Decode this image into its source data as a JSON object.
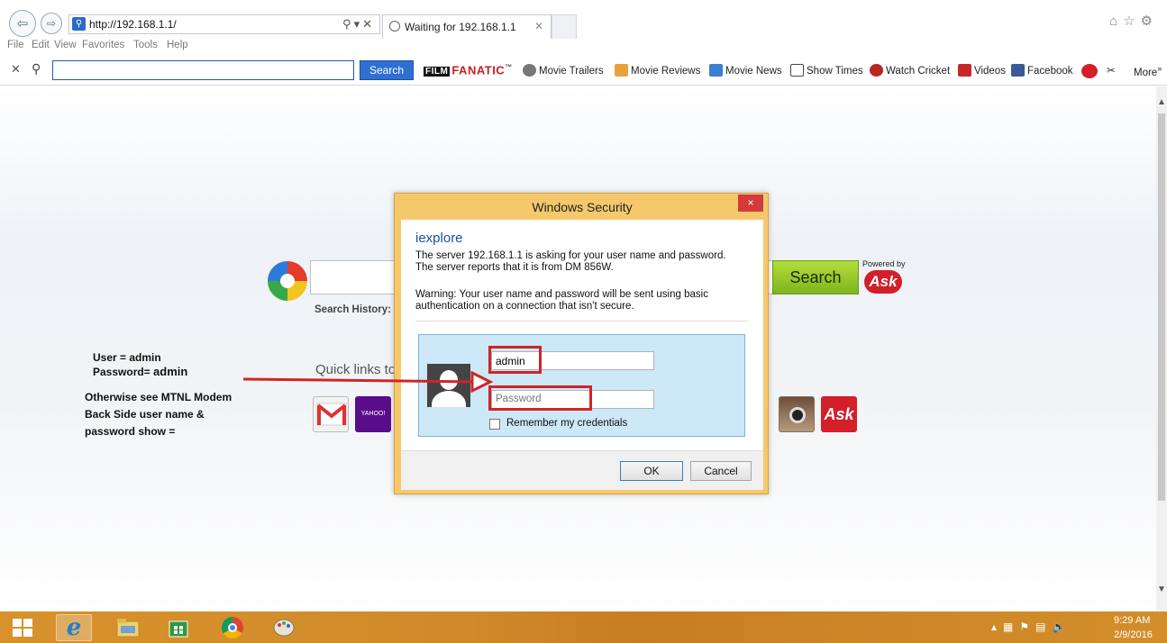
{
  "browser": {
    "address_url": "http://192.168.1.1/",
    "tab_title": "Waiting for 192.168.1.1",
    "menu": [
      "File",
      "Edit",
      "View",
      "Favorites",
      "Tools",
      "Help"
    ]
  },
  "toolbar": {
    "search_button": "Search",
    "brand_box": "FILM",
    "brand_text": "FANATIC",
    "brand_tm": "™",
    "links": [
      {
        "label": "Movie Trailers",
        "icon": "film-reel-icon"
      },
      {
        "label": "Movie Reviews",
        "icon": "thumbs-up-icon"
      },
      {
        "label": "Movie News",
        "icon": "megaphone-icon"
      },
      {
        "label": "Show Times",
        "icon": "calendar-icon"
      },
      {
        "label": "Watch Cricket",
        "icon": "cricket-ball-icon"
      },
      {
        "label": "Videos",
        "icon": "youtube-icon"
      },
      {
        "label": "Facebook",
        "icon": "facebook-icon"
      }
    ],
    "more_label": "More",
    "more_chevron": "»"
  },
  "page": {
    "search_button": "Search",
    "powered_by": "Powered by",
    "ask_logo": "Ask",
    "search_history_label": "Search History:",
    "quick_links_label": "Quick links to",
    "yahoo_tile": "YAHOO!",
    "ask_tile": "Ask"
  },
  "annotation": {
    "user_line": "User = admin",
    "password_line_prefix": "Password=",
    "password_line_value": "admin",
    "note_lines": [
      "Otherwise see MTNL Modem",
      "Back Side user name &",
      "password show ="
    ]
  },
  "dialog": {
    "title": "Windows Security",
    "close_glyph": "×",
    "app_name": "iexplore",
    "message": "The server 192.168.1.1 is asking for your user name and password. The server reports that it is from DM 856W.",
    "warning": "Warning: Your user name and password will be sent using basic authentication on a connection that isn't secure.",
    "username_value": "admin",
    "password_placeholder": "Password",
    "remember_label": "Remember my credentials",
    "ok_label": "OK",
    "cancel_label": "Cancel"
  },
  "taskbar": {
    "time": "9:29 AM",
    "date": "2/9/2016"
  },
  "colors": {
    "taskbar": "#d38e2b",
    "dialog_frame": "#f4c86b",
    "annotation_red": "#d02427",
    "ask_red": "#d21f2a",
    "search_green": "#8cc22a"
  }
}
